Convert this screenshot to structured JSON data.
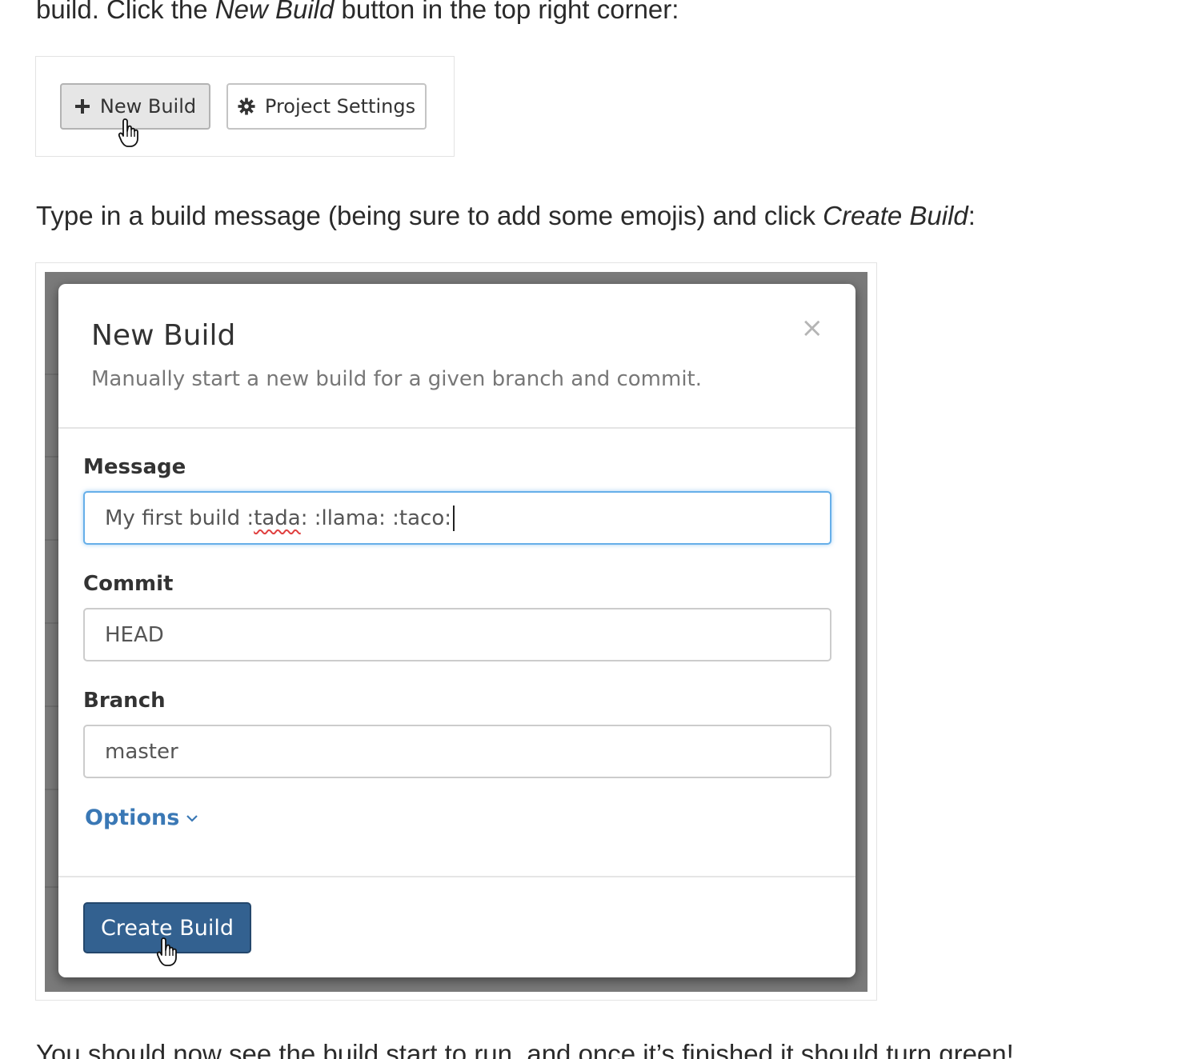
{
  "paragraphs": {
    "p1_before": "build. Click the ",
    "p1_em": "New Build",
    "p1_after": " button in the top right corner:",
    "p2_before": "Type in a build message (being sure to add some emojis) and click ",
    "p2_em": "Create Build",
    "p2_after": ":",
    "p3": "You should now see the build start to run, and once it’s finished it should turn green!"
  },
  "toolbar": {
    "new_build_label": "New Build",
    "new_build_icon": "plus-icon",
    "project_settings_label": "Project Settings",
    "project_settings_icon": "gear-icon"
  },
  "modal": {
    "title": "New Build",
    "subtitle": "Manually start a new build for a given branch and commit.",
    "close_glyph": "×",
    "message_label": "Message",
    "message_value_prefix": "My first build :",
    "message_value_misspelled": "tada",
    "message_value_suffix": ": :llama: :taco:",
    "commit_label": "Commit",
    "commit_value": "HEAD",
    "branch_label": "Branch",
    "branch_value": "master",
    "options_label": "Options",
    "create_label": "Create Build"
  },
  "colors": {
    "primary_button": "#336190",
    "link": "#3a78b5",
    "focus_border": "#66afe9"
  }
}
